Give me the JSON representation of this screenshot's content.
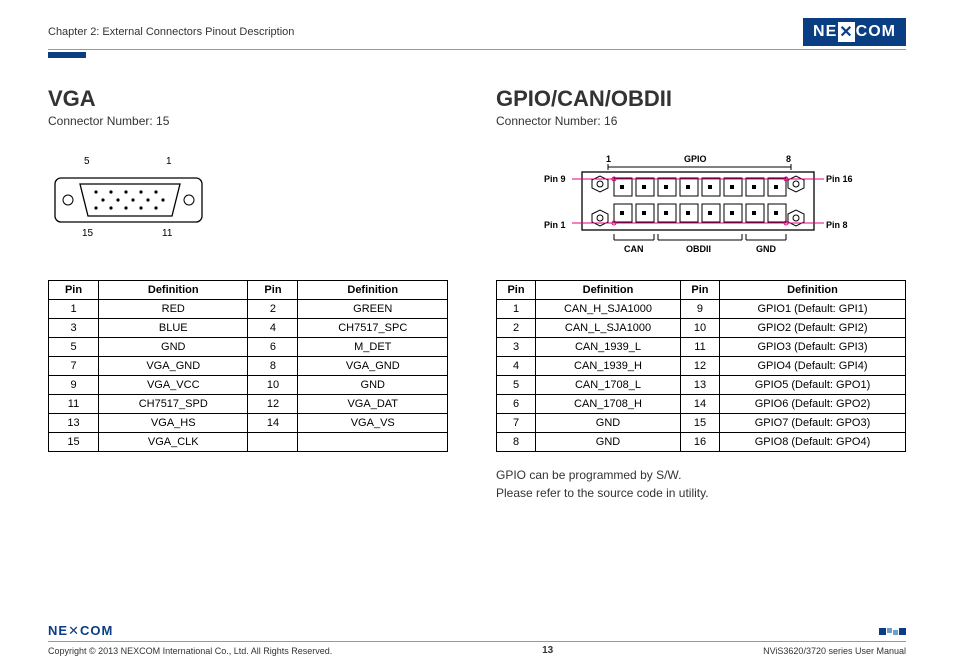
{
  "header": {
    "chapter": "Chapter 2: External Connectors Pinout Description",
    "logo_text": "NE COM",
    "logo_x": "X"
  },
  "left": {
    "heading": "VGA",
    "connector": "Connector Number: 15",
    "labels": {
      "tl": "5",
      "tr": "1",
      "bl": "15",
      "br": "11"
    },
    "th1": "Pin",
    "th2": "Definition",
    "th3": "Pin",
    "th4": "Definition",
    "rows": [
      {
        "p1": "1",
        "d1": "RED",
        "p2": "2",
        "d2": "GREEN"
      },
      {
        "p1": "3",
        "d1": "BLUE",
        "p2": "4",
        "d2": "CH7517_SPC"
      },
      {
        "p1": "5",
        "d1": "GND",
        "p2": "6",
        "d2": "M_DET"
      },
      {
        "p1": "7",
        "d1": "VGA_GND",
        "p2": "8",
        "d2": "VGA_GND"
      },
      {
        "p1": "9",
        "d1": "VGA_VCC",
        "p2": "10",
        "d2": "GND"
      },
      {
        "p1": "11",
        "d1": "CH7517_SPD",
        "p2": "12",
        "d2": "VGA_DAT"
      },
      {
        "p1": "13",
        "d1": "VGA_HS",
        "p2": "14",
        "d2": "VGA_VS"
      },
      {
        "p1": "15",
        "d1": "VGA_CLK",
        "p2": "",
        "d2": ""
      }
    ]
  },
  "right": {
    "heading": "GPIO/CAN/OBDII",
    "connector": "Connector Number: 16",
    "labels": {
      "one": "1",
      "gpio": "GPIO",
      "eight": "8",
      "pin9": "Pin 9",
      "pin16": "Pin 16",
      "pin1": "Pin 1",
      "pin8": "Pin 8",
      "can": "CAN",
      "obdii": "OBDII",
      "gnd": "GND"
    },
    "th1": "Pin",
    "th2": "Definition",
    "th3": "Pin",
    "th4": "Definition",
    "rows": [
      {
        "p1": "1",
        "d1": "CAN_H_SJA1000",
        "p2": "9",
        "d2": "GPIO1 (Default: GPI1)"
      },
      {
        "p1": "2",
        "d1": "CAN_L_SJA1000",
        "p2": "10",
        "d2": "GPIO2 (Default: GPI2)"
      },
      {
        "p1": "3",
        "d1": "CAN_1939_L",
        "p2": "11",
        "d2": "GPIO3 (Default: GPI3)"
      },
      {
        "p1": "4",
        "d1": "CAN_1939_H",
        "p2": "12",
        "d2": "GPIO4 (Default: GPI4)"
      },
      {
        "p1": "5",
        "d1": "CAN_1708_L",
        "p2": "13",
        "d2": "GPIO5 (Default: GPO1)"
      },
      {
        "p1": "6",
        "d1": "CAN_1708_H",
        "p2": "14",
        "d2": "GPIO6 (Default: GPO2)"
      },
      {
        "p1": "7",
        "d1": "GND",
        "p2": "15",
        "d2": "GPIO7 (Default: GPO3)"
      },
      {
        "p1": "8",
        "d1": "GND",
        "p2": "16",
        "d2": "GPIO8 (Default: GPO4)"
      }
    ],
    "note1": "GPIO can be programmed by S/W.",
    "note2": "Please refer to the source code in utility."
  },
  "footer": {
    "logo": "NEXCOM",
    "copyright": "Copyright © 2013 NEXCOM International Co., Ltd. All Rights Reserved.",
    "page": "13",
    "manual": "NViS3620/3720 series User Manual"
  }
}
